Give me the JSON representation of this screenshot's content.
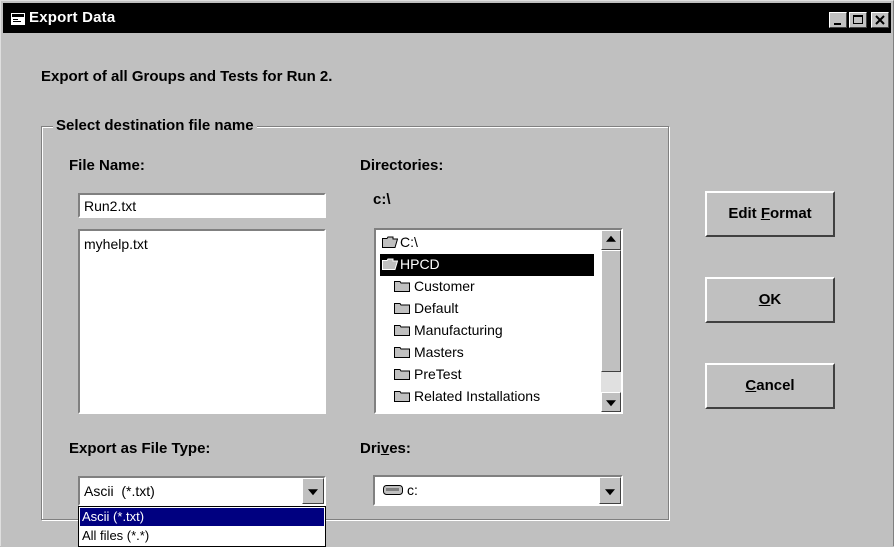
{
  "window": {
    "title": "Export Data",
    "controls": [
      "minimize",
      "maximize",
      "close"
    ]
  },
  "description": "Export of all Groups and Tests for Run 2.",
  "group": {
    "label": "Select destination file name",
    "file_name": {
      "label": "File Name:",
      "value": "Run2.txt",
      "files": [
        "myhelp.txt"
      ]
    },
    "directories": {
      "label": "Directories:",
      "current_path": "c:\\",
      "items": [
        {
          "name": "C:\\",
          "state": "open"
        },
        {
          "name": "HPCD",
          "state": "open",
          "selected": true
        },
        {
          "name": "Customer",
          "state": "closed"
        },
        {
          "name": "Default",
          "state": "closed"
        },
        {
          "name": "Manufacturing",
          "state": "closed"
        },
        {
          "name": "Masters",
          "state": "closed"
        },
        {
          "name": "PreTest",
          "state": "closed"
        },
        {
          "name": "Related Installations",
          "state": "closed"
        }
      ]
    },
    "file_type": {
      "label": "Export as File Type:",
      "value": "Ascii  (*.txt)",
      "options": [
        "Ascii  (*.txt)",
        "All files (*.*)"
      ],
      "selected_index": 0
    },
    "drives": {
      "label_before": "Dri",
      "label_mnemonic": "v",
      "label_after": "es:",
      "value": "c:"
    }
  },
  "buttons": {
    "edit_format": {
      "before": "Edit ",
      "mnemonic": "F",
      "after": "ormat"
    },
    "ok": {
      "before": "",
      "mnemonic": "O",
      "after": "K"
    },
    "cancel": {
      "before": "",
      "mnemonic": "C",
      "after": "ancel"
    }
  },
  "colors": {
    "face": "#c0c0c0",
    "titlebar": "#000000",
    "selection": "#000080"
  }
}
